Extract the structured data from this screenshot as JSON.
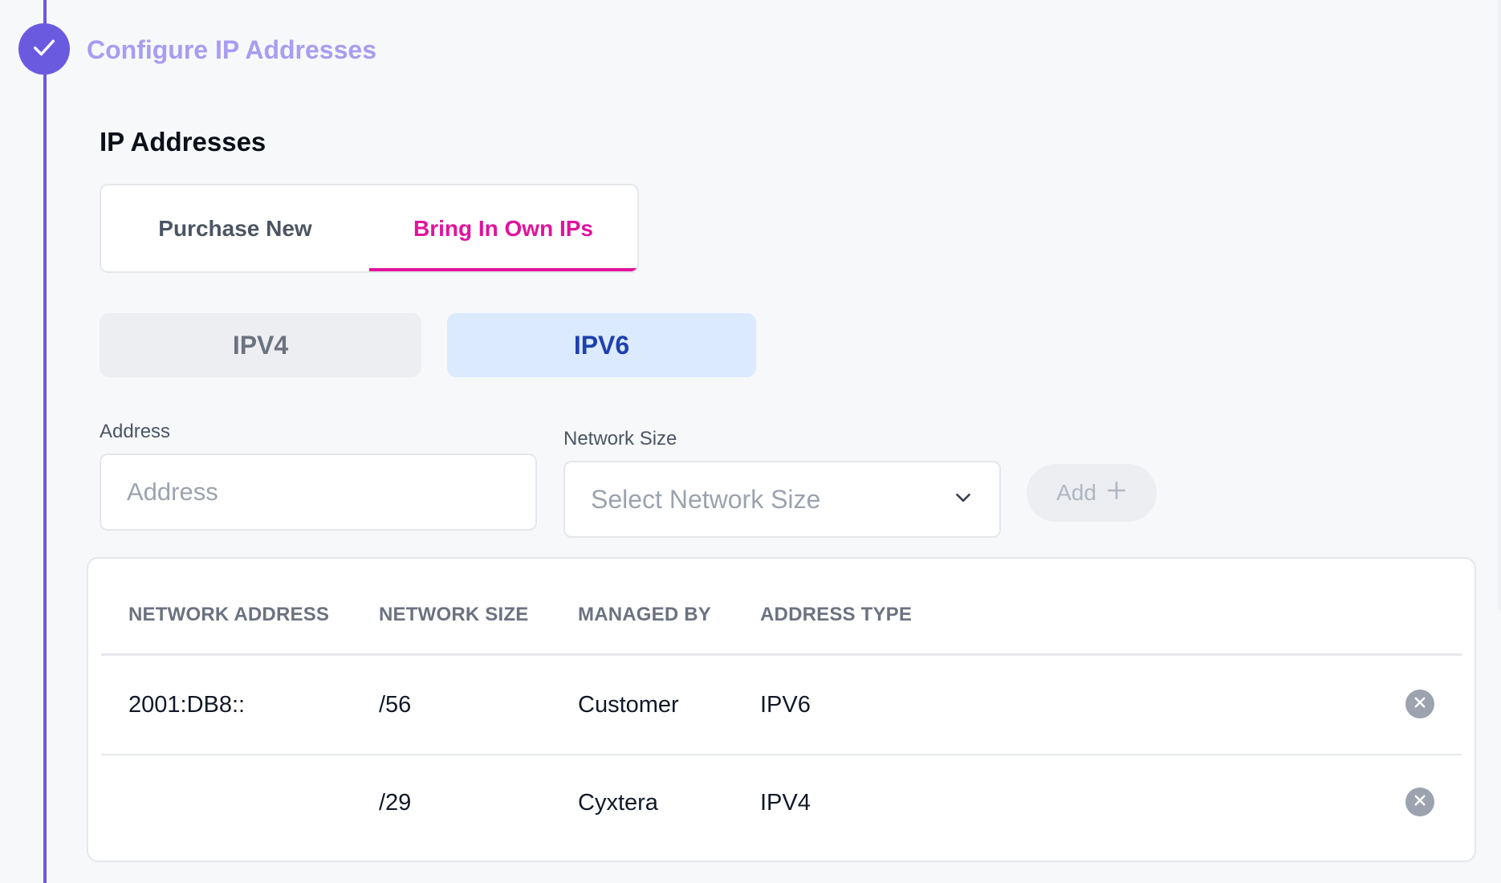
{
  "step": {
    "title": "Configure IP Addresses",
    "icon": "check-icon",
    "accent_color": "#6a5ae0"
  },
  "section": {
    "title": "IP Addresses"
  },
  "tabs": [
    {
      "label": "Purchase New",
      "active": false
    },
    {
      "label": "Bring In Own IPs",
      "active": true
    }
  ],
  "ip_version": {
    "options": [
      "IPV4",
      "IPV6"
    ],
    "selected": "IPV6"
  },
  "form": {
    "address_label": "Address",
    "address_placeholder": "Address",
    "address_value": "",
    "network_size_label": "Network Size",
    "network_size_placeholder": "Select Network Size",
    "add_label": "Add"
  },
  "table": {
    "headers": [
      "NETWORK ADDRESS",
      "NETWORK SIZE",
      "MANAGED BY",
      "ADDRESS TYPE"
    ],
    "rows": [
      {
        "network_address": "2001:DB8::",
        "network_size": "/56",
        "managed_by": "Customer",
        "address_type": "IPV6"
      },
      {
        "network_address": "",
        "network_size": "/29",
        "managed_by": "Cyxtera",
        "address_type": "IPV4"
      }
    ]
  },
  "colors": {
    "active_tab": "#e0139c",
    "selected_ipv_bg": "#dbeafe",
    "selected_ipv_text": "#1e40af"
  }
}
